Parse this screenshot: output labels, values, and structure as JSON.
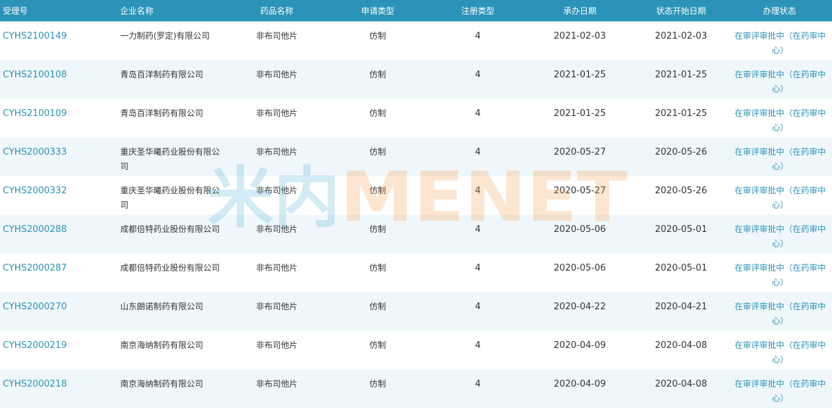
{
  "columns": [
    "受理号",
    "企业名称",
    "药品名称",
    "申请类型",
    "注册类型",
    "承办日期",
    "状态开始日期",
    "办理状态"
  ],
  "rows": [
    {
      "id": "CYHS2100149",
      "company": "一力制药(罗定)有限公司",
      "drug": "非布司他片",
      "app_type": "仿制",
      "reg_type": "4",
      "undertake_date": "2021-02-03",
      "status_start": "2021-02-03",
      "status": "在审评审批中（在药审中心）"
    },
    {
      "id": "CYHS2100108",
      "company": "青岛百洋制药有限公司",
      "drug": "非布司他片",
      "app_type": "仿制",
      "reg_type": "4",
      "undertake_date": "2021-01-25",
      "status_start": "2021-01-25",
      "status": "在审评审批中（在药审中心）"
    },
    {
      "id": "CYHS2100109",
      "company": "青岛百洋制药有限公司",
      "drug": "非布司他片",
      "app_type": "仿制",
      "reg_type": "4",
      "undertake_date": "2021-01-25",
      "status_start": "2021-01-25",
      "status": "在审评审批中（在药审中心）"
    },
    {
      "id": "CYHS2000333",
      "company": "重庆圣华曦药业股份有限公司",
      "drug": "非布司他片",
      "app_type": "仿制",
      "reg_type": "4",
      "undertake_date": "2020-05-27",
      "status_start": "2020-05-26",
      "status": "在审评审批中（在药审中心）"
    },
    {
      "id": "CYHS2000332",
      "company": "重庆圣华曦药业股份有限公司",
      "drug": "非布司他片",
      "app_type": "仿制",
      "reg_type": "4",
      "undertake_date": "2020-05-27",
      "status_start": "2020-05-26",
      "status": "在审评审批中（在药审中心）"
    },
    {
      "id": "CYHS2000288",
      "company": "成都倍特药业股份有限公司",
      "drug": "非布司他片",
      "app_type": "仿制",
      "reg_type": "4",
      "undertake_date": "2020-05-06",
      "status_start": "2020-05-01",
      "status": "在审评审批中（在药审中心）"
    },
    {
      "id": "CYHS2000287",
      "company": "成都倍特药业股份有限公司",
      "drug": "非布司他片",
      "app_type": "仿制",
      "reg_type": "4",
      "undertake_date": "2020-05-06",
      "status_start": "2020-05-01",
      "status": "在审评审批中（在药审中心）"
    },
    {
      "id": "CYHS2000270",
      "company": "山东朗诺制药有限公司",
      "drug": "非布司他片",
      "app_type": "仿制",
      "reg_type": "4",
      "undertake_date": "2020-04-22",
      "status_start": "2020-04-21",
      "status": "在审评审批中（在药审中心）"
    },
    {
      "id": "CYHS2000219",
      "company": "南京海纳制药有限公司",
      "drug": "非布司他片",
      "app_type": "仿制",
      "reg_type": "4",
      "undertake_date": "2020-04-09",
      "status_start": "2020-04-08",
      "status": "在审评审批中（在药审中心）"
    },
    {
      "id": "CYHS2000218",
      "company": "南京海纳制药有限公司",
      "drug": "非布司他片",
      "app_type": "仿制",
      "reg_type": "4",
      "undertake_date": "2020-04-09",
      "status_start": "2020-04-08",
      "status": "在审评审批中（在药审中心）"
    }
  ],
  "watermark": {
    "cn": "米内",
    "en": "MENET"
  },
  "colors": {
    "header_bg": "#2b93b8",
    "link": "#2b93b8",
    "row_alt": "#f0f7fb",
    "watermark_blue": "#4fb3d9",
    "watermark_orange": "#f4a04a"
  }
}
